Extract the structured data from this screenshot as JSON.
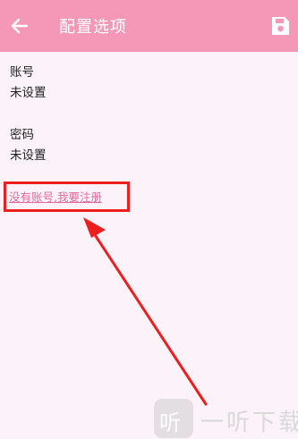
{
  "toolbar": {
    "title": "配置选项",
    "back_icon": "arrow-left-icon",
    "save_icon": "save-disk-icon",
    "background": "#f597b6"
  },
  "preferences": [
    {
      "label": "账号",
      "value": "未设置"
    },
    {
      "label": "密码",
      "value": "未设置"
    }
  ],
  "register": {
    "link_text": "没有账号,我要注册",
    "link_color": "#e56a9d",
    "highlight_color": "#ec1f1f"
  },
  "watermark": {
    "icon_glyph": "听",
    "text": "一听下载"
  }
}
